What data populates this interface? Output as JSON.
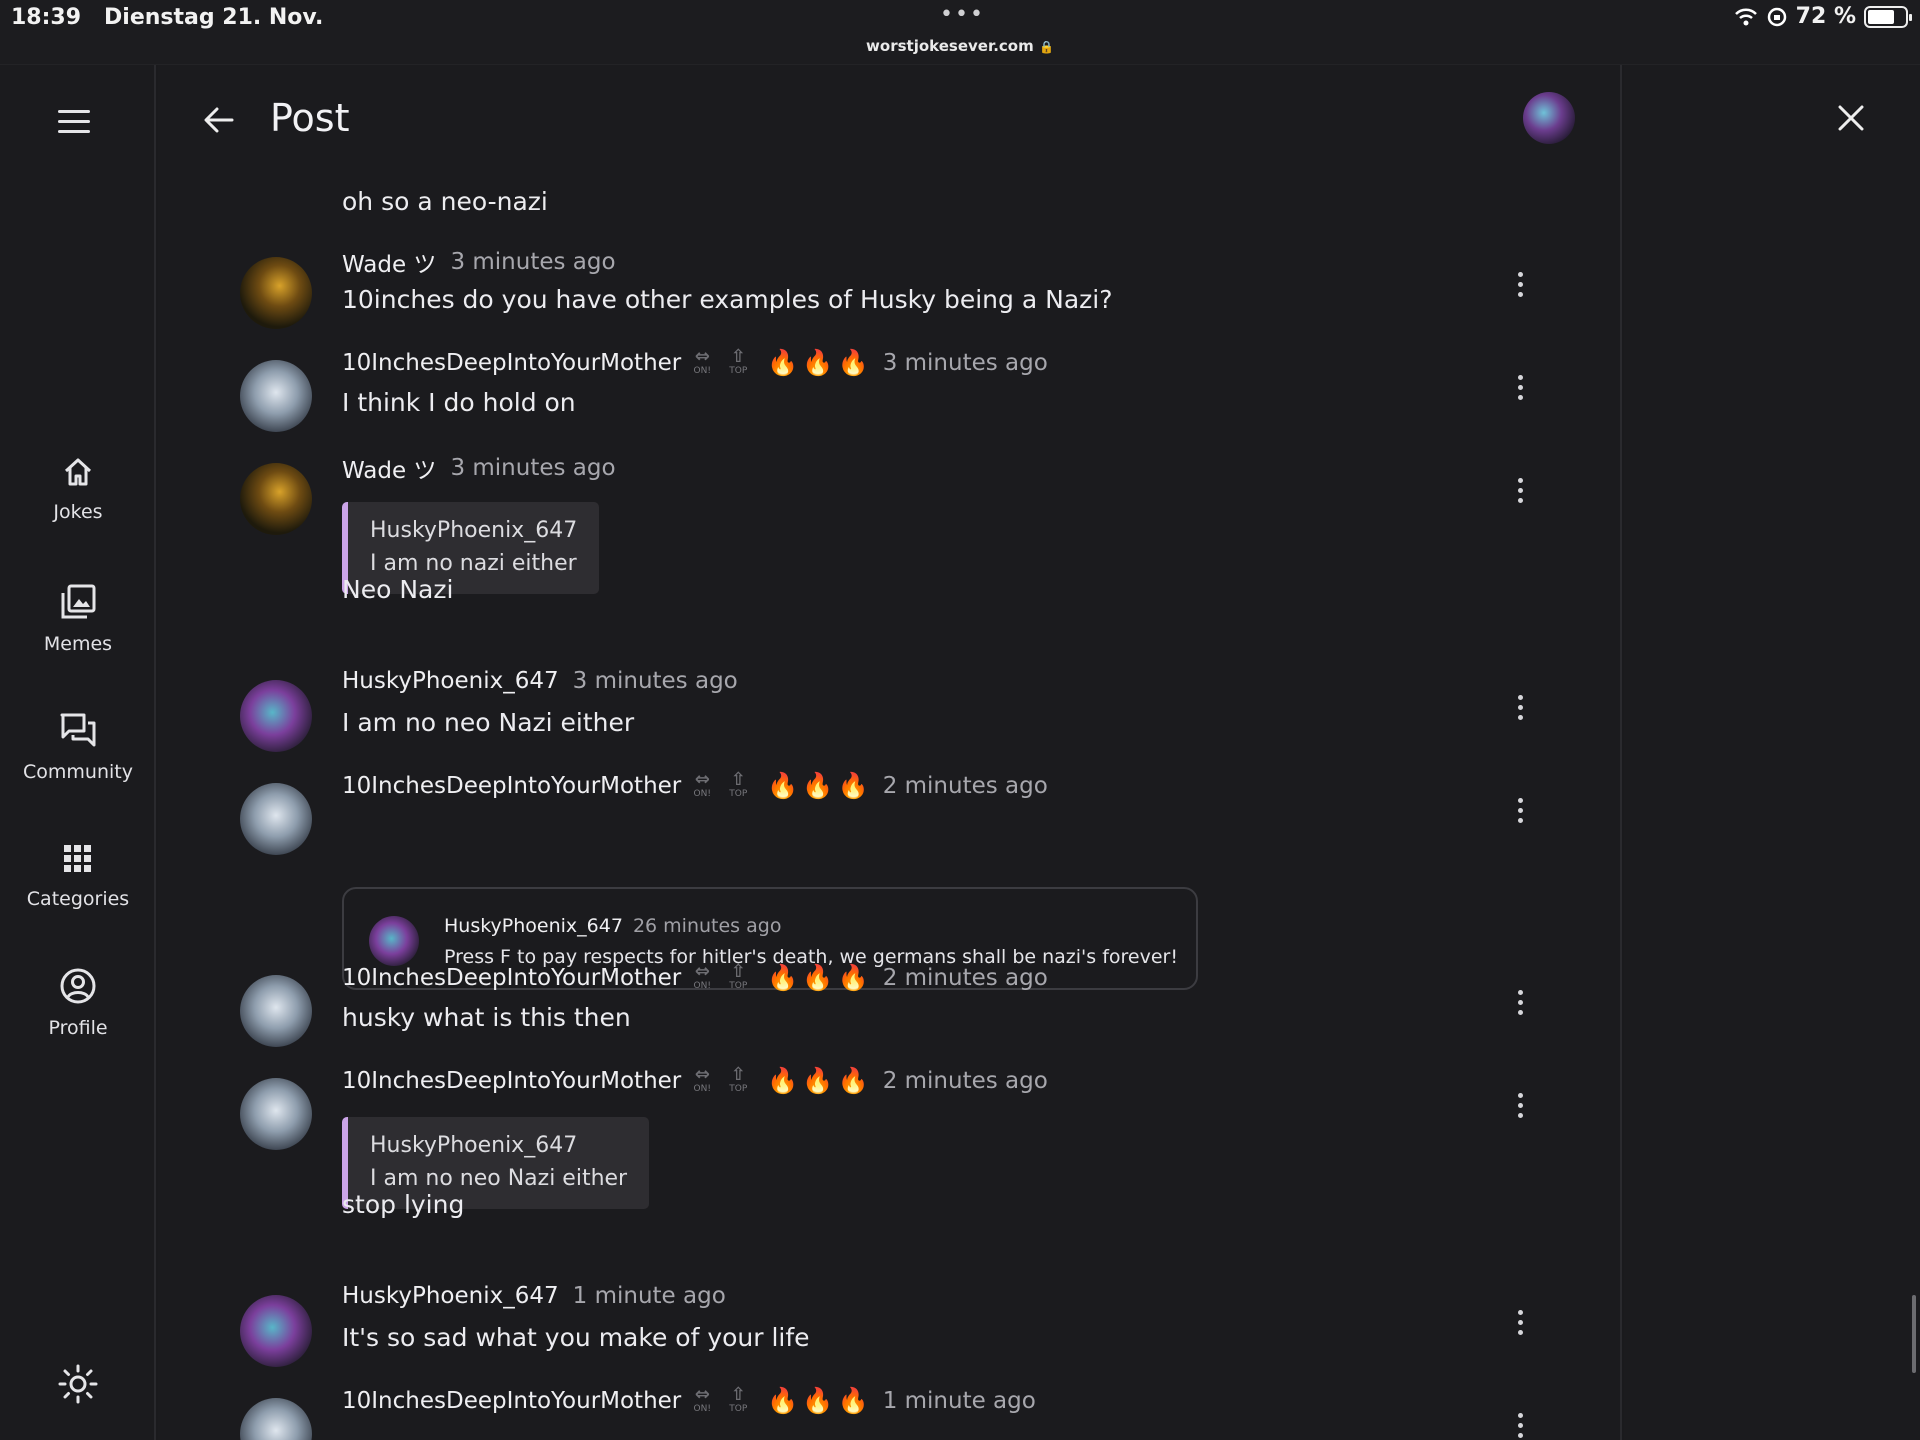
{
  "status_bar": {
    "time": "18:39",
    "date": "Dienstag 21. Nov.",
    "dots": "•••",
    "url": "worstjokesever.com",
    "battery": "72 %",
    "battery_level": 0.72
  },
  "sidebar": {
    "items": [
      {
        "label": "Jokes",
        "icon": "home-icon"
      },
      {
        "label": "Memes",
        "icon": "images-icon"
      },
      {
        "label": "Community",
        "icon": "chat-icon"
      },
      {
        "label": "Categories",
        "icon": "grid-icon"
      },
      {
        "label": "Profile",
        "icon": "account-icon"
      }
    ],
    "theme_icon": "sun-icon"
  },
  "header": {
    "title": "Post"
  },
  "top_text": "oh so a neo-nazi",
  "badges": {
    "on": "ON!",
    "top": "TOP"
  },
  "flame": "🔥",
  "comments": [
    {
      "user": "Wade ツ",
      "time": "3 minutes ago",
      "text": "10inches do you have other examples of Husky being a Nazi?"
    },
    {
      "user": "10InchesDeepIntoYourMother",
      "time": "3 minutes ago",
      "text": "I think I do hold on"
    },
    {
      "user": "Wade ツ",
      "time": "3 minutes ago",
      "quote_user": "HuskyPhoenix_647",
      "quote_text": "I am no nazi either",
      "text": "Neo Nazi"
    },
    {
      "user": "HuskyPhoenix_647",
      "time": "3 minutes ago",
      "text": "I am no neo Nazi either"
    },
    {
      "user": "10InchesDeepIntoYourMother",
      "time": "2 minutes ago",
      "embed_user": "HuskyPhoenix_647",
      "embed_time": "26 minutes ago",
      "embed_text": "Press F to pay respects for hitler's death, we germans shall be nazi's forever!"
    },
    {
      "user": "10InchesDeepIntoYourMother",
      "time": "2 minutes ago",
      "text": "husky what is this then"
    },
    {
      "user": "10InchesDeepIntoYourMother",
      "time": "2 minutes ago",
      "quote_user": "HuskyPhoenix_647",
      "quote_text": "I am no neo Nazi either",
      "text": "stop lying"
    },
    {
      "user": "HuskyPhoenix_647",
      "time": "1 minute ago",
      "text": "It's so sad what you make of your life"
    },
    {
      "user": "10InchesDeepIntoYourMother",
      "time": "1 minute ago"
    }
  ]
}
